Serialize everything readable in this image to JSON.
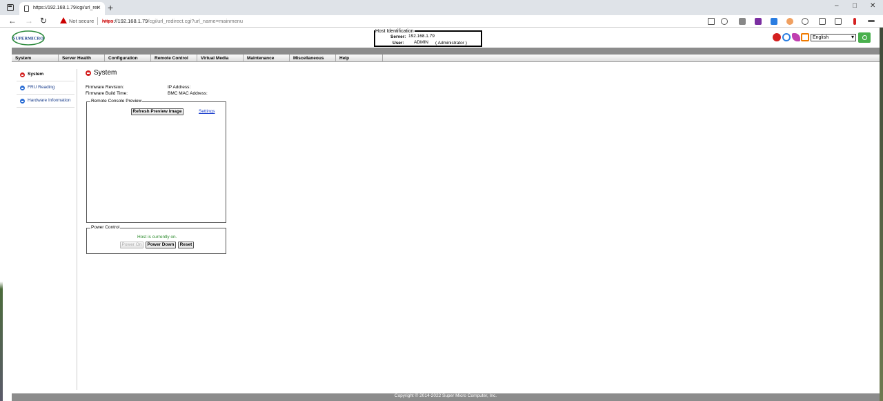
{
  "browser": {
    "tab_title": "https://192.168.1.79/cgi/url_redi",
    "close_glyph": "×",
    "new_tab_glyph": "+",
    "not_secure": "Not secure",
    "url_scheme": "https",
    "url_host": "://192.168.1.79",
    "url_path": "/cgi/url_redirect.cgi?url_name=mainmenu",
    "minimize": "–",
    "maximize": "□",
    "close": "✕",
    "back": "←",
    "forward": "→",
    "reload": "↻"
  },
  "header": {
    "host_identification_title": "Host Identification",
    "server_label": "Server:",
    "server_value": "192.168.1.79",
    "user_label": "User:",
    "user_value": "ADMIN",
    "user_role": "( Administrator )",
    "language": "English"
  },
  "menu": [
    "System",
    "Server Health",
    "Configuration",
    "Remote Control",
    "Virtual Media",
    "Maintenance",
    "Miscellaneous",
    "Help"
  ],
  "sidebar": [
    {
      "label": "System",
      "active": true
    },
    {
      "label": "FRU Reading",
      "active": false
    },
    {
      "label": "Hardware Information",
      "active": false
    }
  ],
  "main": {
    "title": "System",
    "firmware_revision_label": "Firmware Revision:",
    "firmware_build_time_label": "Firmware Build Time:",
    "ip_address_label": "IP Address:",
    "bmc_mac_label": "BMC MAC Address:",
    "remote_console_legend": "Remote Console Preview",
    "refresh_preview_button": "Refresh Preview Image",
    "settings_link": "Settings",
    "power_control_legend": "Power Control",
    "host_status": "Host is currently on.",
    "power_on_button": "Power On",
    "power_down_button": "Power Down",
    "reset_button": "Reset"
  },
  "footer": {
    "copyright": "Copyright © 2014-2022 Super Micro Computer, Inc."
  },
  "colors": {
    "accent_green": "#49b04d",
    "active_red": "#d42020",
    "link_blue": "#1a3ecc",
    "status_green": "#2a8a2a"
  }
}
